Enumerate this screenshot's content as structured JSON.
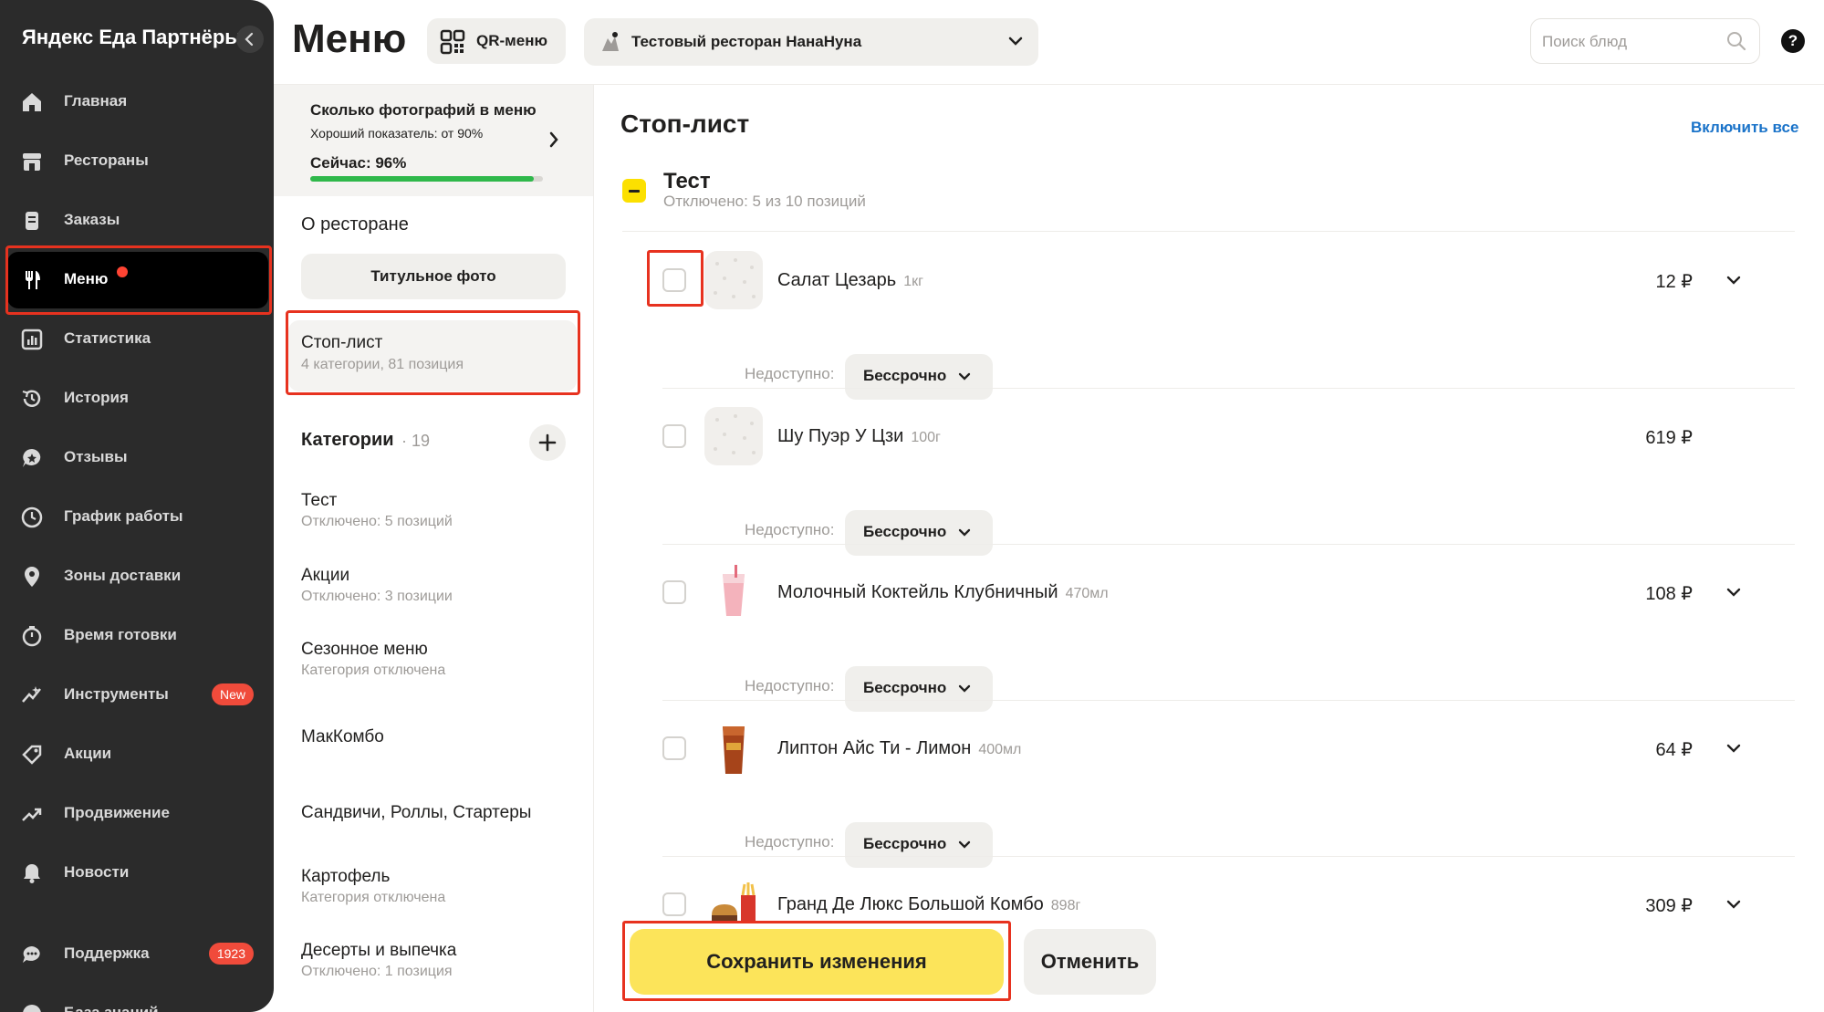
{
  "sidebar": {
    "brand": "Яндекс Еда Партнёры",
    "items": [
      {
        "label": "Главная",
        "icon": "home-icon"
      },
      {
        "label": "Рестораны",
        "icon": "store-icon"
      },
      {
        "label": "Заказы",
        "icon": "orders-icon"
      },
      {
        "label": "Меню",
        "icon": "fork-knife-icon",
        "active": true,
        "dot": true
      },
      {
        "label": "Статистика",
        "icon": "stats-icon"
      },
      {
        "label": "История",
        "icon": "history-icon"
      },
      {
        "label": "Отзывы",
        "icon": "reviews-icon"
      },
      {
        "label": "График работы",
        "icon": "clock-icon"
      },
      {
        "label": "Зоны доставки",
        "icon": "location-pin-icon"
      },
      {
        "label": "Время готовки",
        "icon": "timer-icon"
      },
      {
        "label": "Инструменты",
        "icon": "tools-icon",
        "badge": "New"
      },
      {
        "label": "Акции",
        "icon": "tag-icon"
      },
      {
        "label": "Продвижение",
        "icon": "trend-icon"
      },
      {
        "label": "Новости",
        "icon": "bell-icon"
      },
      {
        "label": "Поддержка",
        "icon": "chat-icon",
        "badge": "1923"
      },
      {
        "label": "База знаний",
        "icon": "help-icon"
      }
    ]
  },
  "header": {
    "title": "Меню",
    "qr_label": "QR-меню",
    "restaurant": "Тестовый ресторан НанаНуна",
    "search_placeholder": "Поиск блюд",
    "help": "?"
  },
  "photo_card": {
    "title": "Сколько фотографий в меню",
    "sub": "Хороший показатель: от 90%",
    "now": "Сейчас: 96%",
    "progress": 0.96
  },
  "middle": {
    "about": "О ресторане",
    "title_photo": "Титульное фото",
    "stoplist_title": "Стоп-лист",
    "stoplist_sub": "4 категории, 81 позиция",
    "categories_title": "Категории",
    "categories_count": "· 19",
    "categories": [
      {
        "title": "Тест",
        "sub": "Отключено: 5 позиций"
      },
      {
        "title": "Акции",
        "sub": "Отключено: 3 позиции"
      },
      {
        "title": "Сезонное меню",
        "sub": "Категория отключена"
      },
      {
        "title": "МакКомбо",
        "sub": ""
      },
      {
        "title": "Сандвичи, Роллы, Стартеры",
        "sub": ""
      },
      {
        "title": "Картофель",
        "sub": "Категория отключена"
      },
      {
        "title": "Десерты и выпечка",
        "sub": "Отключено: 1 позиция"
      }
    ]
  },
  "stoplist": {
    "title": "Стоп-лист",
    "enable_all": "Включить все",
    "group_title": "Тест",
    "group_sub": "Отключено: 5 из 10 позиций",
    "unavailable_label": "Недоступно:",
    "items": [
      {
        "name": "Салат Цезарь",
        "weight": "1кг",
        "price": "12 ₽",
        "duration": "Бессрочно",
        "thumb": "placeholder"
      },
      {
        "name": "Шу Пуэр У Цзи",
        "weight": "100г",
        "price": "619 ₽",
        "duration": "Бессрочно",
        "thumb": "placeholder"
      },
      {
        "name": "Молочный Коктейль Клубничный",
        "weight": "470мл",
        "price": "108 ₽",
        "duration": "Бессрочно",
        "thumb": "milkshake"
      },
      {
        "name": "Липтон Айс Ти - Лимон",
        "weight": "400мл",
        "price": "64 ₽",
        "duration": "Бессрочно",
        "thumb": "icetea"
      },
      {
        "name": "Гранд Де Люкс Большой Комбо",
        "weight": "898г",
        "price": "309 ₽",
        "duration": "",
        "thumb": "combo"
      }
    ]
  },
  "footer": {
    "save": "Сохранить изменения",
    "cancel": "Отменить"
  },
  "colors": {
    "sidebar_bg": "#2b2b2b",
    "accent_yellow": "#fce45a",
    "link_blue": "#1a73c9",
    "highlight_red": "#e7321f",
    "progress_green": "#2fb84b"
  }
}
